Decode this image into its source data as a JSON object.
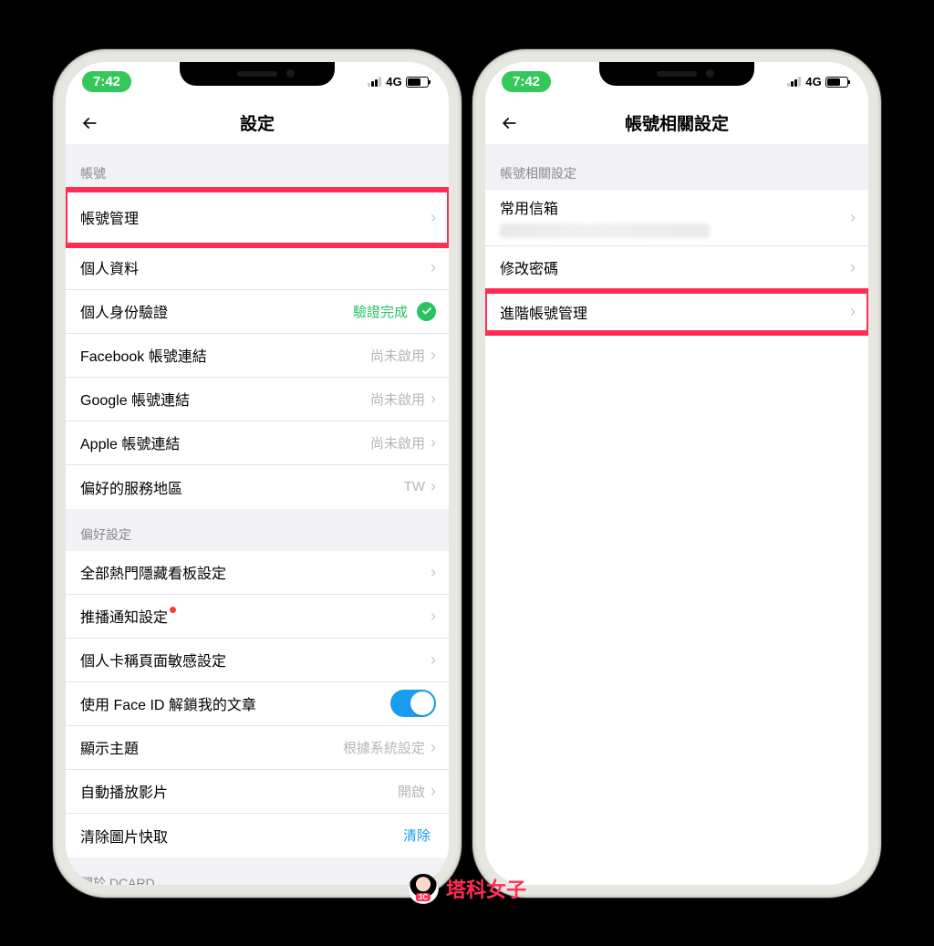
{
  "status": {
    "time": "7:42",
    "network": "4G"
  },
  "left": {
    "title": "設定",
    "sections": {
      "account": {
        "header": "帳號",
        "rows": {
          "manage": {
            "label": "帳號管理"
          },
          "profile": {
            "label": "個人資料"
          },
          "identity": {
            "label": "個人身份驗證",
            "value": "驗證完成"
          },
          "facebook": {
            "label": "Facebook 帳號連結",
            "value": "尚未啟用"
          },
          "google": {
            "label": "Google 帳號連結",
            "value": "尚未啟用"
          },
          "apple": {
            "label": "Apple 帳號連結",
            "value": "尚未啟用"
          },
          "region": {
            "label": "偏好的服務地區",
            "value": "TW"
          }
        }
      },
      "prefs": {
        "header": "偏好設定",
        "rows": {
          "board": {
            "label": "全部熱門隱藏看板設定"
          },
          "push": {
            "label": "推播通知設定"
          },
          "sensitive": {
            "label": "個人卡稱頁面敏感設定"
          },
          "faceid": {
            "label": "使用 Face ID 解鎖我的文章"
          },
          "theme": {
            "label": "顯示主題",
            "value": "根據系統設定"
          },
          "autoplay": {
            "label": "自動播放影片",
            "value": "開啟"
          },
          "clearcache": {
            "label": "清除圖片快取",
            "value": "清除"
          }
        }
      },
      "about": {
        "header": "關於 DCARD"
      }
    }
  },
  "right": {
    "title": "帳號相關設定",
    "section_header": "帳號相關設定",
    "rows": {
      "email": {
        "label": "常用信箱"
      },
      "password": {
        "label": "修改密碼"
      },
      "advanced": {
        "label": "進階帳號管理"
      }
    }
  },
  "watermark": "塔科女子"
}
